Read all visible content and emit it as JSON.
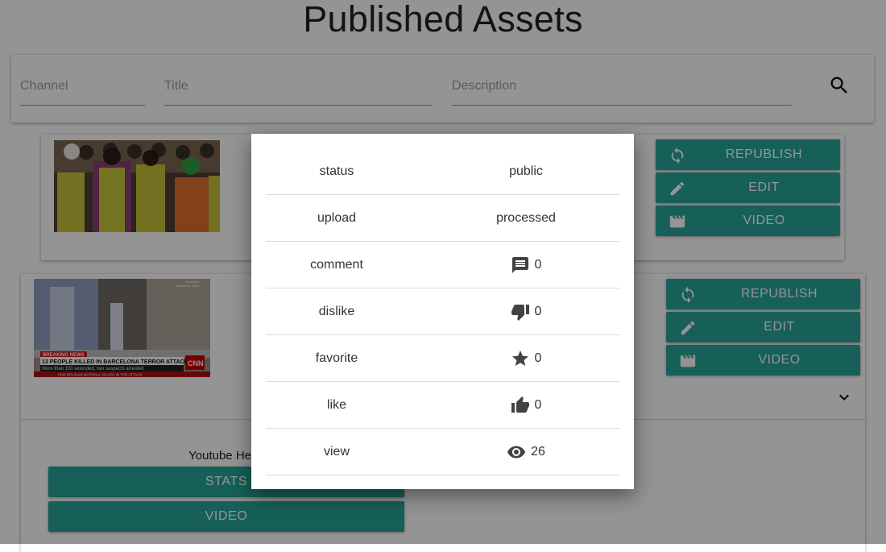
{
  "page": {
    "title": "Published Assets"
  },
  "filters": {
    "channel_placeholder": "Channel",
    "title_placeholder": "Title",
    "description_placeholder": "Description",
    "search_icon": "search-icon"
  },
  "assets": [
    {
      "thumbnail": "construction-workers-video",
      "buttons": {
        "republish": "REPUBLISH",
        "edit": "EDIT",
        "video": "VIDEO"
      }
    },
    {
      "thumbnail": "cnn-breaking-news-video",
      "news": {
        "banner": "BREAKING NEWS",
        "headline": "13 PEOPLE KILLED IN BARCELONA TERROR ATTACK",
        "subline": "More than 100 wounded, two suspects arrested",
        "ticker": "ONE BELGIAN NATIONAL KILLED IN THE ATTACK",
        "network": "CNN",
        "day": "Thursday",
        "location": "Barcelona, Spain"
      },
      "buttons": {
        "republish": "REPUBLISH",
        "edit": "EDIT",
        "video": "VIDEO"
      },
      "expanded": {
        "channel_label": "Youtube Hexa",
        "stats_button": "STATS",
        "video_button": "VIDEO"
      }
    }
  ],
  "stats_modal": {
    "rows": [
      {
        "key": "status",
        "value": "public",
        "icon": ""
      },
      {
        "key": "upload",
        "value": "processed",
        "icon": ""
      },
      {
        "key": "comment",
        "value": "0",
        "icon": "comment-icon"
      },
      {
        "key": "dislike",
        "value": "0",
        "icon": "thumbs-down-icon"
      },
      {
        "key": "favorite",
        "value": "0",
        "icon": "star-icon"
      },
      {
        "key": "like",
        "value": "0",
        "icon": "thumbs-up-icon"
      },
      {
        "key": "view",
        "value": "26",
        "icon": "eye-icon"
      }
    ]
  },
  "colors": {
    "accent": "#26a69a",
    "overlay": "rgba(0,0,0,0.42)"
  }
}
